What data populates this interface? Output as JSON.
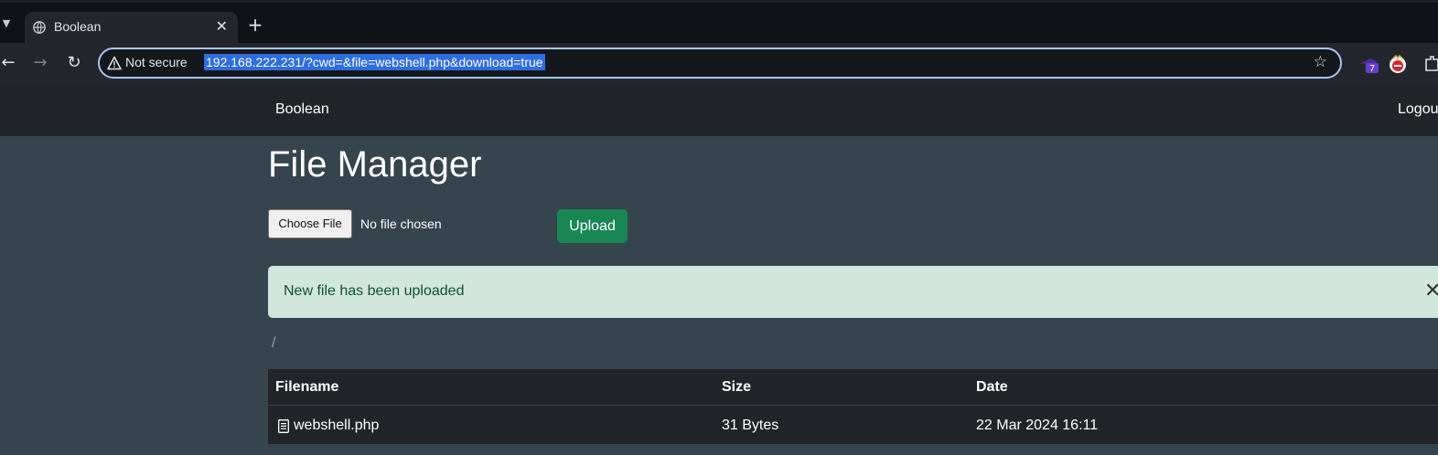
{
  "browser": {
    "tab_title": "Boolean",
    "security_label": "Not secure",
    "url": "192.168.222.231/?cwd=&file=webshell.php&download=true",
    "extension_badge": "7"
  },
  "navbar": {
    "brand": "Boolean",
    "logout": "Logout"
  },
  "page": {
    "title": "File Manager",
    "choose_file_label": "Choose File",
    "file_status": "No file chosen",
    "upload_label": "Upload",
    "alert_message": "New file has been uploaded",
    "path": "/"
  },
  "table": {
    "headers": [
      "Filename",
      "Size",
      "Date"
    ],
    "rows": [
      {
        "filename": "webshell.php",
        "size": "31 Bytes",
        "date": "22 Mar 2024 16:11"
      }
    ]
  },
  "colors": {
    "accent_upload": "#198754",
    "alert_bg": "#d1e7dd",
    "navbar_bg": "#212529",
    "page_bg": "#36444d"
  }
}
